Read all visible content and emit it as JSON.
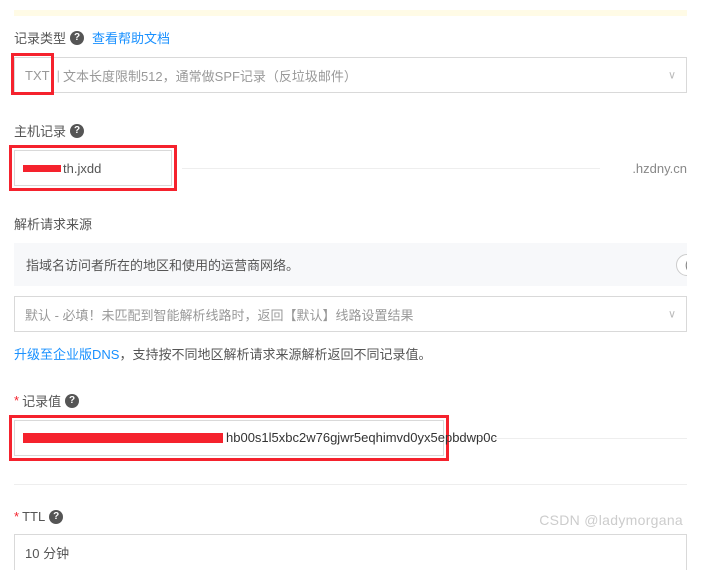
{
  "recordType": {
    "label": "记录类型",
    "helpLink": "查看帮助文档",
    "selectPrefix": "TXT",
    "selectText": "文本长度限制512，通常做SPF记录（反垃圾邮件）"
  },
  "hostRecord": {
    "label": "主机记录",
    "visibleValue": "th.jxdd",
    "domainSuffix": ".hzdny.cn"
  },
  "requestSource": {
    "label": "解析请求来源",
    "infoText": "指域名访问者所在的地区和使用的运营商网络。",
    "selectText": "默认 - 必填！未匹配到智能解析线路时，返回【默认】线路设置结果",
    "upgradeLink": "升级至企业版DNS",
    "upgradeText": "，支持按不同地区解析请求来源解析返回不同记录值。"
  },
  "recordValue": {
    "label": "记录值",
    "visibleValue": "hb00s1l5xbc2w76gjwr5eqhimvd0yx5epbdwp0c"
  },
  "ttl": {
    "label": "TTL",
    "value": "10 分钟"
  },
  "watermark": "CSDN @ladymorgana"
}
